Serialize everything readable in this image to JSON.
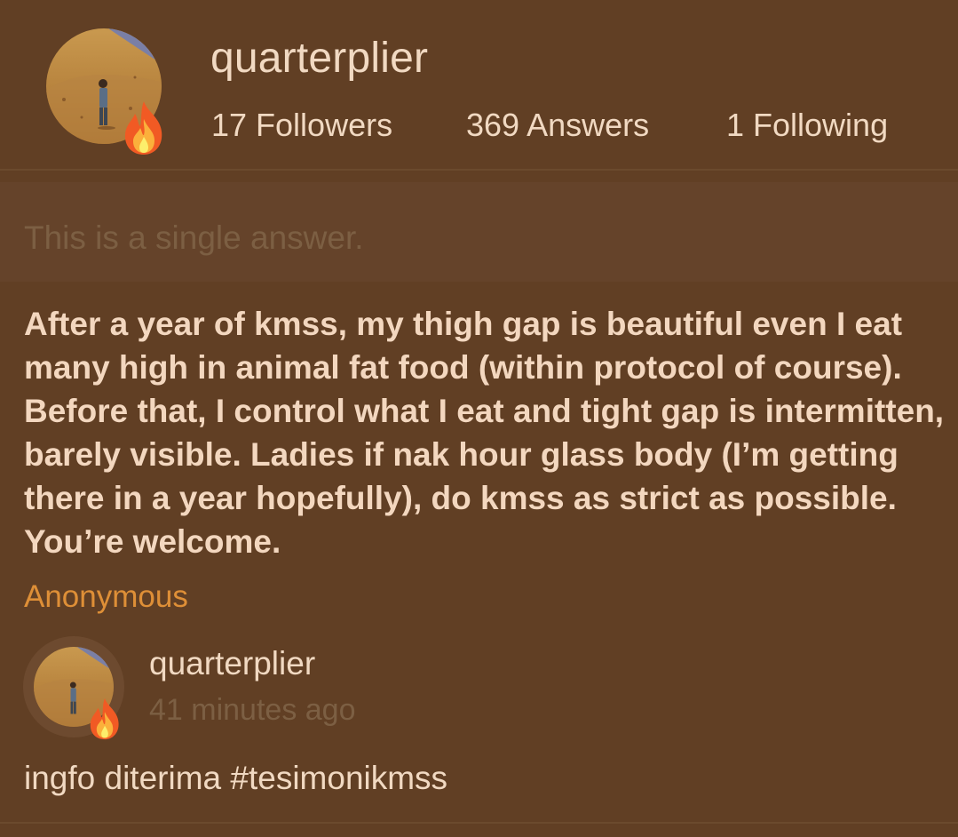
{
  "profile": {
    "username": "quarterplier",
    "followers": "17 Followers",
    "answers": "369 Answers",
    "following": "1 Following",
    "avatar_icon": "person-in-desert-avatar",
    "badge_icon": "fire-icon"
  },
  "banner": {
    "text": "This is a single answer."
  },
  "question": {
    "text": "After a year of kmss, my thigh gap is beautiful even I eat many high in animal fat food (within protocol of course). Before that, I control what I eat and tight gap is intermitten, barely visible. Ladies if nak hour glass body (I’m getting there in a year hopefully), do kmss as strict as possible. You’re welcome.",
    "asker": "Anonymous"
  },
  "answer": {
    "username": "quarterplier",
    "time_ago": "41 minutes ago",
    "text": "ingfo diterima #tesimonikmss"
  },
  "colors": {
    "background": "#613f24",
    "text": "#f1d9c2",
    "muted": "#7c5f43",
    "accent": "#de8f37"
  }
}
